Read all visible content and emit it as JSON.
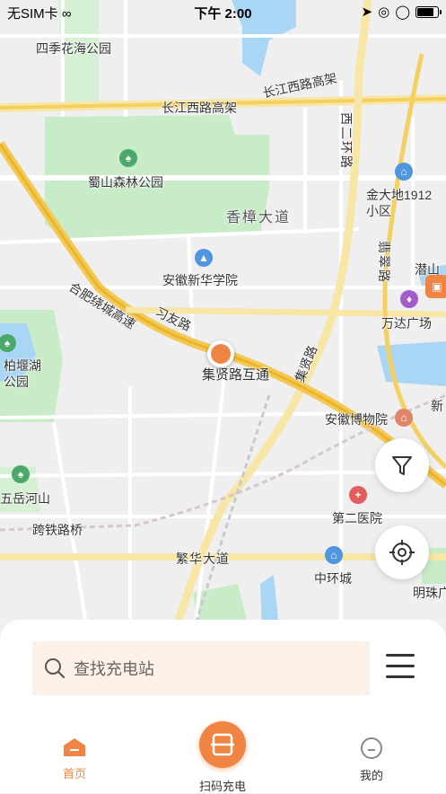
{
  "status_bar": {
    "carrier": "无SIM卡",
    "time": "下午 2:00"
  },
  "map": {
    "labels": {
      "park_sijihuahai": "四季花海公园",
      "road_changjiangxilu": "长江西路高架",
      "road_changjiangxilu2": "长江西路高架",
      "park_shushan": "蜀山森林公园",
      "road_xiangzhang": "香樟大道",
      "school_xinhua": "安徽新华学院",
      "road_raocheng": "合肥绕城高速",
      "road_xiyou": "习友路",
      "interchange_jixian": "集贤路互通",
      "road_jixian": "集贤路",
      "community_jindadi": "金大地1912\n小区",
      "road_xierhuan": "西二环路",
      "road_feicui": "翡翠路",
      "mall_wanda": "万达广场",
      "park_baiyanhu": "柏堰湖\n公园",
      "museum": "安徽博物院",
      "park_wuyuehe": "五岳河山",
      "hospital2": "第二医院",
      "road_kuatie": "跨铁路桥",
      "road_fanhua": "繁华大道",
      "zhonghuancheng": "中环城",
      "mingzhu": "明珠广",
      "qianshan": "潜山",
      "xin": "新"
    }
  },
  "search": {
    "placeholder": "查找充电站"
  },
  "tabs": {
    "home": "首页",
    "scan": "扫码充电",
    "mine": "我的"
  },
  "colors": {
    "accent": "#f08543",
    "green_park": "#c9ecc8",
    "water": "#a9d6f5",
    "highway": "#f3c855"
  }
}
